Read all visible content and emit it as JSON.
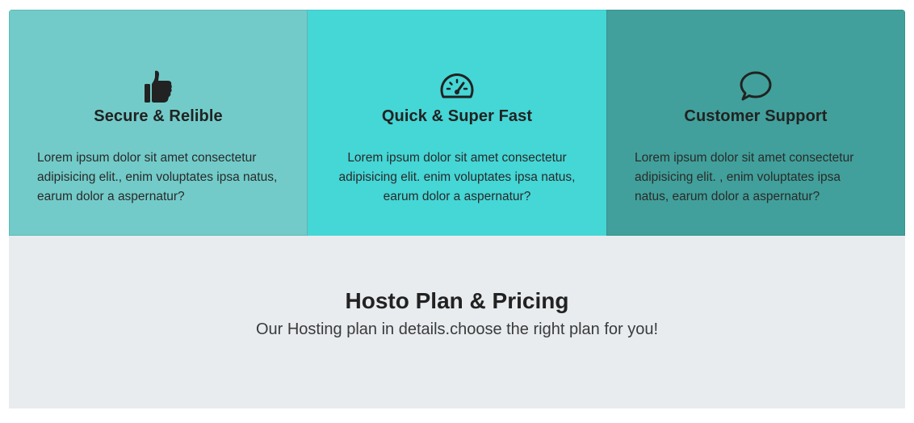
{
  "features": [
    {
      "icon": "thumbs-up-icon",
      "title": "Secure & Relible",
      "text": "Lorem ipsum dolor sit amet consectetur adipisicing elit., enim voluptates ipsa natus, earum dolor a aspernatur?",
      "background": "#72cbc9"
    },
    {
      "icon": "speedometer-icon",
      "title": "Quick & Super Fast",
      "text": "Lorem ipsum dolor sit amet consectetur adipisicing elit. enim voluptates ipsa natus, earum dolor a aspernatur?",
      "background": "#45d6d6"
    },
    {
      "icon": "chat-bubble-icon",
      "title": "Customer Support",
      "text": "Lorem ipsum dolor sit amet consectetur adipisicing elit. , enim voluptates ipsa natus, earum dolor a aspernatur?",
      "background": "#41a09b"
    }
  ],
  "pricing": {
    "title": "Hosto Plan & Pricing",
    "subtitle": "Our Hosting plan in details.choose the right plan for you!",
    "background": "#e8ecef"
  }
}
